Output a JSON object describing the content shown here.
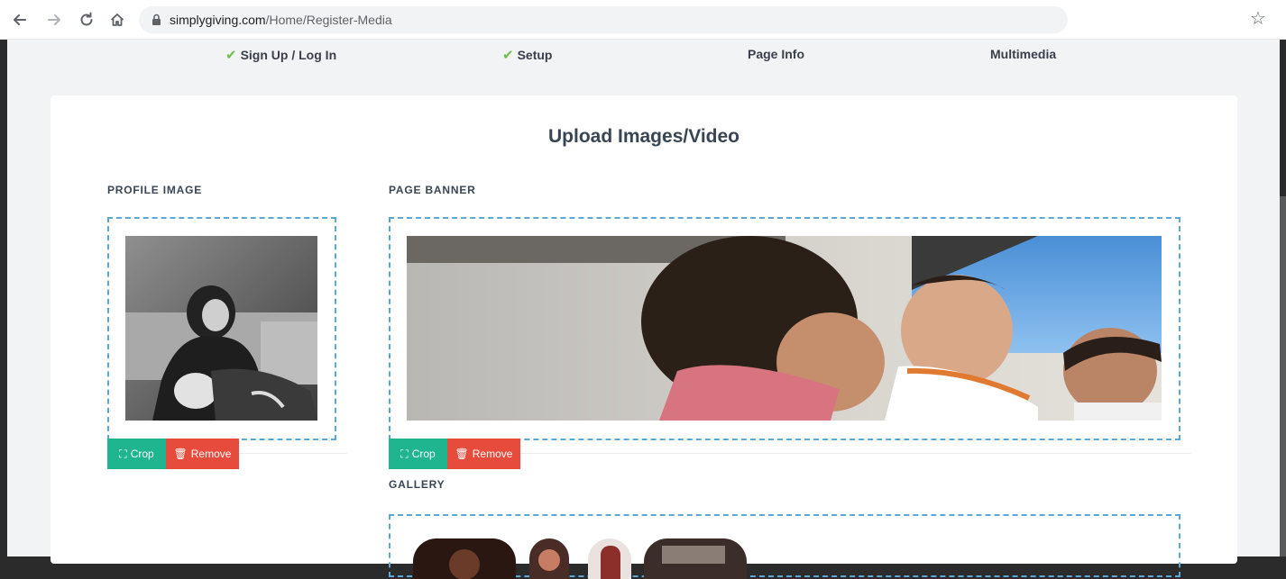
{
  "browser": {
    "url_host": "simplygiving.com",
    "url_path": "/Home/Register-Media"
  },
  "steps": [
    {
      "label": "Sign Up / Log In",
      "done": true
    },
    {
      "label": "Setup",
      "done": true
    },
    {
      "label": "Page Info",
      "done": false
    },
    {
      "label": "Multimedia",
      "done": false
    }
  ],
  "main": {
    "title": "Upload Images/Video",
    "profile": {
      "label": "PROFILE IMAGE",
      "crop_label": "Crop",
      "remove_label": "Remove"
    },
    "banner": {
      "label": "PAGE BANNER",
      "crop_label": "Crop",
      "remove_label": "Remove"
    },
    "gallery": {
      "label": "GALLERY"
    }
  },
  "colors": {
    "accent_green": "#1fb58f",
    "danger_red": "#e74b3c",
    "check_green": "#6fc04a",
    "dropzone_blue": "#5aa7d8"
  }
}
